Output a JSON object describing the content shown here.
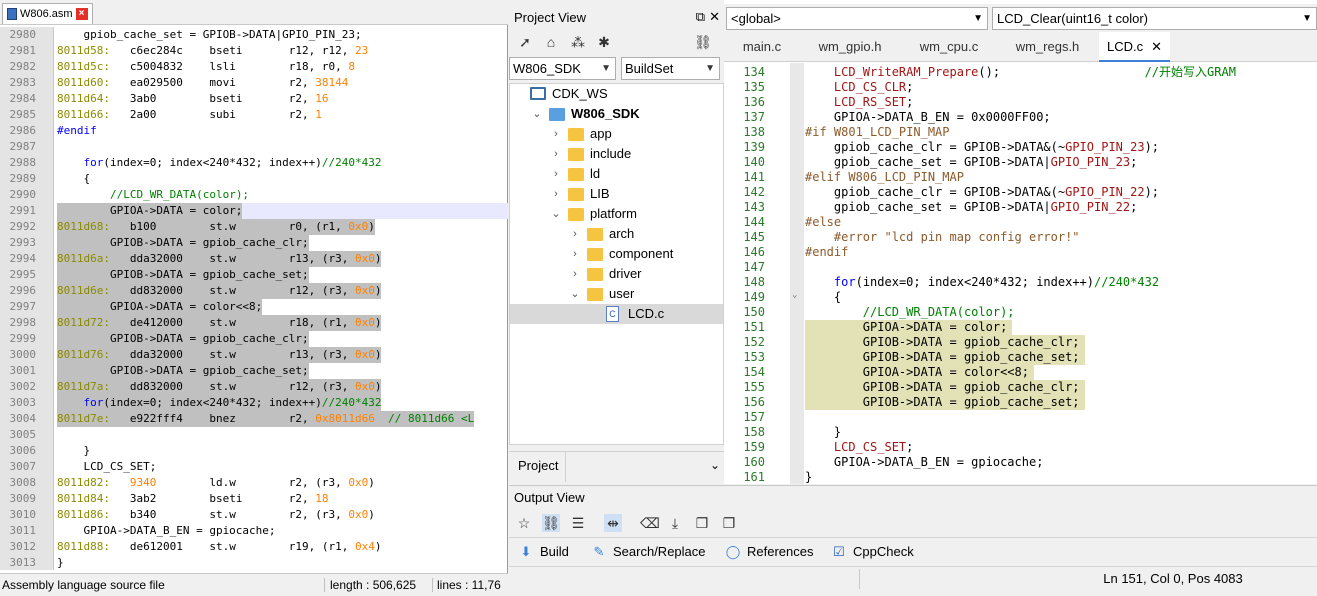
{
  "asm": {
    "tab_label": "W806.asm",
    "lines": [
      {
        "n": "2980",
        "t": "    gpiob_cache_set = GPIOB->DATA|GPIO_PIN_23;"
      },
      {
        "n": "2981",
        "t": "8011d58:   c6ec284c    bseti       r12, r12, 23"
      },
      {
        "n": "2982",
        "t": "8011d5c:   c5004832    lsli        r18, r0, 8"
      },
      {
        "n": "2983",
        "t": "8011d60:   ea029500    movi        r2, 38144"
      },
      {
        "n": "2984",
        "t": "8011d64:   3ab0        bseti       r2, 16"
      },
      {
        "n": "2985",
        "t": "8011d66:   2a00        subi        r2, 1"
      },
      {
        "n": "2986",
        "t": "#endif"
      },
      {
        "n": "2987",
        "t": ""
      },
      {
        "n": "2988",
        "t": "    for(index=0; index<240*432; index++)//240*432"
      },
      {
        "n": "2989",
        "t": "    {"
      },
      {
        "n": "2990",
        "t": "        //LCD_WR_DATA(color);"
      },
      {
        "n": "2991",
        "t": "        GPIOA->DATA = color;"
      },
      {
        "n": "2992",
        "t": "8011d68:   b100        st.w        r0, (r1, 0x0)"
      },
      {
        "n": "2993",
        "t": "        GPIOB->DATA = gpiob_cache_clr;"
      },
      {
        "n": "2994",
        "t": "8011d6a:   dda32000    st.w        r13, (r3, 0x0)"
      },
      {
        "n": "2995",
        "t": "        GPIOB->DATA = gpiob_cache_set;"
      },
      {
        "n": "2996",
        "t": "8011d6e:   dd832000    st.w        r12, (r3, 0x0)"
      },
      {
        "n": "2997",
        "t": "        GPIOA->DATA = color<<8;"
      },
      {
        "n": "2998",
        "t": "8011d72:   de412000    st.w        r18, (r1, 0x0)"
      },
      {
        "n": "2999",
        "t": "        GPIOB->DATA = gpiob_cache_clr;"
      },
      {
        "n": "3000",
        "t": "8011d76:   dda32000    st.w        r13, (r3, 0x0)"
      },
      {
        "n": "3001",
        "t": "        GPIOB->DATA = gpiob_cache_set;"
      },
      {
        "n": "3002",
        "t": "8011d7a:   dd832000    st.w        r12, (r3, 0x0)"
      },
      {
        "n": "3003",
        "t": "    for(index=0; index<240*432; index++)//240*432"
      },
      {
        "n": "3004",
        "t": "8011d7e:   e922fff4    bnez        r2, 0x8011d66  // 8011d66 <L"
      },
      {
        "n": "3005",
        "t": ""
      },
      {
        "n": "3006",
        "t": "    }"
      },
      {
        "n": "3007",
        "t": "    LCD_CS_SET;"
      },
      {
        "n": "3008",
        "t": "8011d82:   9340        ld.w        r2, (r3, 0x0)"
      },
      {
        "n": "3009",
        "t": "8011d84:   3ab2        bseti       r2, 18"
      },
      {
        "n": "3010",
        "t": "8011d86:   b340        st.w        r2, (r3, 0x0)"
      },
      {
        "n": "3011",
        "t": "    GPIOA->DATA_B_EN = gpiocache;"
      },
      {
        "n": "3012",
        "t": "8011d88:   de612001    st.w        r19, (r1, 0x4)"
      },
      {
        "n": "3013",
        "t": "}"
      }
    ],
    "status": {
      "type": "Assembly language source file",
      "length": "length : 506,625",
      "lines": "lines : 11,76"
    }
  },
  "project_view": {
    "title": "Project View",
    "workspace_select": "W806_SDK",
    "build_select": "BuildSet",
    "tree": [
      {
        "label": "CDK_WS",
        "depth": 0,
        "kind": "workspace",
        "chev": ""
      },
      {
        "label": "W806_SDK",
        "depth": 1,
        "kind": "project",
        "chev": "down"
      },
      {
        "label": "app",
        "depth": 2,
        "kind": "folder",
        "chev": "right"
      },
      {
        "label": "include",
        "depth": 2,
        "kind": "folder",
        "chev": "right"
      },
      {
        "label": "ld",
        "depth": 2,
        "kind": "folder",
        "chev": "right"
      },
      {
        "label": "LIB",
        "depth": 2,
        "kind": "folder",
        "chev": "right"
      },
      {
        "label": "platform",
        "depth": 2,
        "kind": "folder",
        "chev": "down"
      },
      {
        "label": "arch",
        "depth": 3,
        "kind": "folder",
        "chev": "right"
      },
      {
        "label": "component",
        "depth": 3,
        "kind": "folder",
        "chev": "right"
      },
      {
        "label": "driver",
        "depth": 3,
        "kind": "folder",
        "chev": "right"
      },
      {
        "label": "user",
        "depth": 3,
        "kind": "folder",
        "chev": "down"
      },
      {
        "label": "LCD.c",
        "depth": 4,
        "kind": "cfile",
        "chev": ""
      }
    ],
    "bottom_tab": "Project"
  },
  "editor": {
    "scope_combo": "<global>",
    "func_combo": "LCD_Clear(uint16_t color)",
    "tabs": [
      {
        "label": "main.c",
        "active": false
      },
      {
        "label": "wm_gpio.h",
        "active": false
      },
      {
        "label": "wm_cpu.c",
        "active": false
      },
      {
        "label": "wm_regs.h",
        "active": false
      },
      {
        "label": "LCD.c",
        "active": true
      }
    ],
    "lines": [
      {
        "n": "134",
        "t": "    LCD_WriteRAM_Prepare();                    //开始写入GRAM"
      },
      {
        "n": "135",
        "t": "    LCD_CS_CLR;"
      },
      {
        "n": "136",
        "t": "    LCD_RS_SET;"
      },
      {
        "n": "137",
        "t": "    GPIOA->DATA_B_EN = 0x0000FF00;"
      },
      {
        "n": "138",
        "t": "#if W801_LCD_PIN_MAP"
      },
      {
        "n": "139",
        "t": "    gpiob_cache_clr = GPIOB->DATA&(~GPIO_PIN_23);"
      },
      {
        "n": "140",
        "t": "    gpiob_cache_set = GPIOB->DATA|GPIO_PIN_23;"
      },
      {
        "n": "141",
        "t": "#elif W806_LCD_PIN_MAP"
      },
      {
        "n": "142",
        "t": "    gpiob_cache_clr = GPIOB->DATA&(~GPIO_PIN_22);"
      },
      {
        "n": "143",
        "t": "    gpiob_cache_set = GPIOB->DATA|GPIO_PIN_22;"
      },
      {
        "n": "144",
        "t": "#else"
      },
      {
        "n": "145",
        "t": "    #error \"lcd pin map config error!\""
      },
      {
        "n": "146",
        "t": "#endif"
      },
      {
        "n": "147",
        "t": ""
      },
      {
        "n": "148",
        "t": "    for(index=0; index<240*432; index++)//240*432"
      },
      {
        "n": "149",
        "t": "    {"
      },
      {
        "n": "150",
        "t": "        //LCD_WR_DATA(color);"
      },
      {
        "n": "151",
        "t": "        GPIOA->DATA = color;"
      },
      {
        "n": "152",
        "t": "        GPIOB->DATA = gpiob_cache_clr;"
      },
      {
        "n": "153",
        "t": "        GPIOB->DATA = gpiob_cache_set;"
      },
      {
        "n": "154",
        "t": "        GPIOA->DATA = color<<8;"
      },
      {
        "n": "155",
        "t": "        GPIOB->DATA = gpiob_cache_clr;"
      },
      {
        "n": "156",
        "t": "        GPIOB->DATA = gpiob_cache_set;"
      },
      {
        "n": "157",
        "t": ""
      },
      {
        "n": "158",
        "t": "    }"
      },
      {
        "n": "159",
        "t": "    LCD_CS_SET;"
      },
      {
        "n": "160",
        "t": "    GPIOA->DATA_B_EN = gpiocache;"
      },
      {
        "n": "161",
        "t": "}"
      }
    ]
  },
  "output_view": {
    "title": "Output View",
    "tabs": [
      {
        "label": "Build",
        "icon": "download-arrow-icon"
      },
      {
        "label": "Search/Replace",
        "icon": "pencil-icon"
      },
      {
        "label": "References",
        "icon": "circle-icon"
      },
      {
        "label": "CppCheck",
        "icon": "checkbox-icon"
      }
    ],
    "cursor_status": "Ln 151, Col 0, Pos 4083"
  },
  "colors": {
    "selection_asm": "#c0c0c0",
    "selection_editor": "#e2e2b6",
    "accent": "#3b82d6",
    "folder": "#f5c542"
  }
}
